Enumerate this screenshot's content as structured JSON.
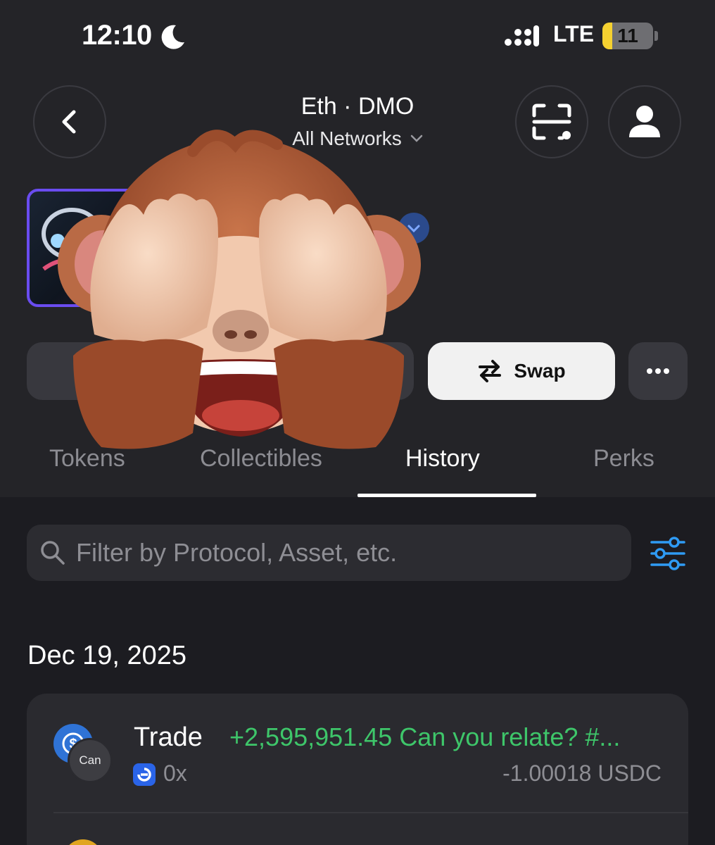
{
  "status_bar": {
    "time": "12:10",
    "network": "LTE",
    "battery": "11"
  },
  "header": {
    "wallet_name": "Eth · DMO",
    "network_selector": "All Networks"
  },
  "actions": {
    "swap_label": "Swap"
  },
  "tabs": [
    {
      "label": "Tokens",
      "active": false
    },
    {
      "label": "Collectibles",
      "active": false
    },
    {
      "label": "History",
      "active": true
    },
    {
      "label": "Perks",
      "active": false
    }
  ],
  "search": {
    "placeholder": "Filter by Protocol, Asset, etc."
  },
  "history": {
    "groups": [
      {
        "date": "Dec 19, 2025",
        "items": [
          {
            "type": "Trade",
            "protocol": "0x",
            "token_badge": "Can",
            "received": "+2,595,951.45 Can you relate? #...",
            "sent": "-1.00018 USDC"
          }
        ]
      }
    ]
  },
  "colors": {
    "accent": "#2f9bf4",
    "positive": "#3ec66a",
    "avatar_border": "#6a4cf0"
  }
}
